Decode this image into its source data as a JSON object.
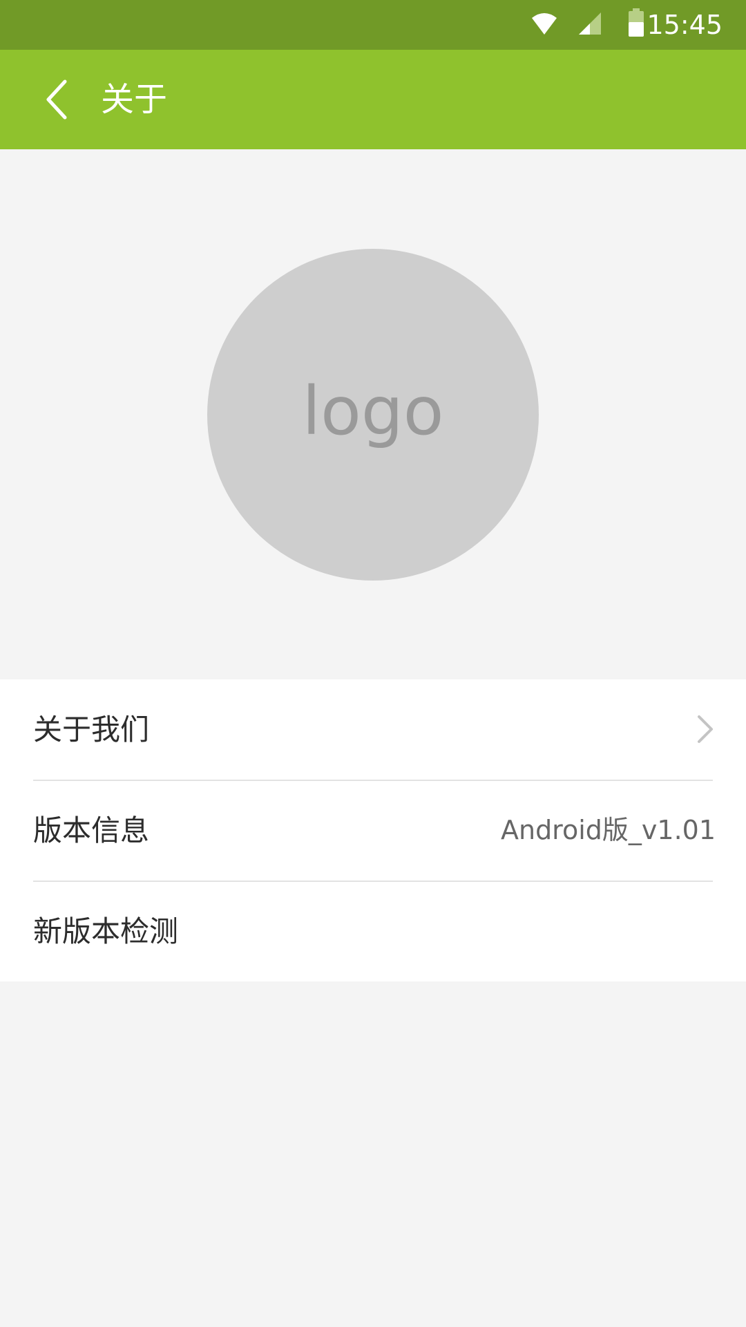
{
  "status_bar": {
    "time": "15:45",
    "icons": [
      "wifi-icon",
      "cell-signal-icon",
      "battery-icon"
    ]
  },
  "toolbar": {
    "back_icon": "chevron-left-icon",
    "title": "关于"
  },
  "logo": {
    "text": "logo"
  },
  "list": {
    "items": [
      {
        "label": "关于我们",
        "trailing_icon": "chevron-right-icon"
      },
      {
        "label": "版本信息",
        "value": "Android版_v1.01"
      },
      {
        "label": "新版本检测"
      }
    ]
  },
  "colors": {
    "status_bar": "#719a27",
    "toolbar": "#8fc22d",
    "background": "#f4f4f4",
    "logo_circle": "#cecece",
    "logo_text": "#9a9a9a"
  }
}
